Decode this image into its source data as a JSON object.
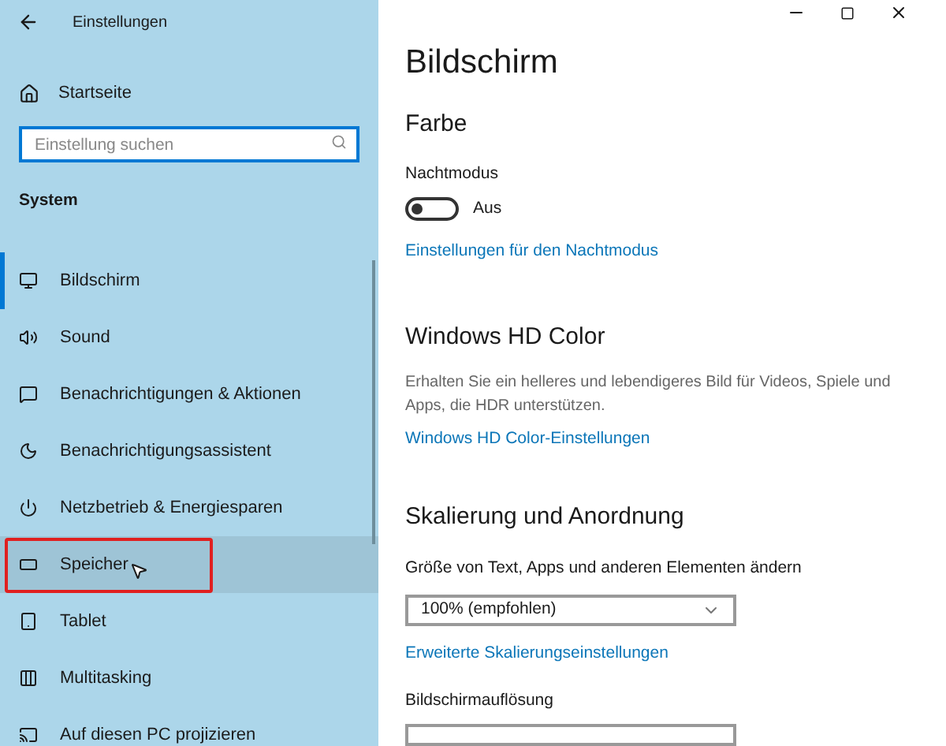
{
  "window": {
    "title": "Einstellungen"
  },
  "sidebar": {
    "home": "Startseite",
    "search": {
      "placeholder": "Einstellung suchen"
    },
    "section": "System",
    "items": [
      {
        "label": "Bildschirm",
        "kind": "monitor",
        "selected": true,
        "hovered": false,
        "annotated": false
      },
      {
        "label": "Sound",
        "kind": "sound",
        "selected": false,
        "hovered": false,
        "annotated": false
      },
      {
        "label": "Benachrichtigungen & Aktionen",
        "kind": "message",
        "selected": false,
        "hovered": false,
        "annotated": false
      },
      {
        "label": "Benachrichtigungsassistent",
        "kind": "moon",
        "selected": false,
        "hovered": false,
        "annotated": false
      },
      {
        "label": "Netzbetrieb & Energiesparen",
        "kind": "power",
        "selected": false,
        "hovered": false,
        "annotated": false
      },
      {
        "label": "Speicher",
        "kind": "storage",
        "selected": false,
        "hovered": true,
        "annotated": true
      },
      {
        "label": "Tablet",
        "kind": "tablet",
        "selected": false,
        "hovered": false,
        "annotated": false
      },
      {
        "label": "Multitasking",
        "kind": "multitask",
        "selected": false,
        "hovered": false,
        "annotated": false
      },
      {
        "label": "Auf diesen PC projizieren",
        "kind": "project",
        "selected": false,
        "hovered": false,
        "annotated": false
      }
    ]
  },
  "page": {
    "title": "Bildschirm",
    "color": {
      "heading": "Farbe",
      "toggle": {
        "label": "Nachtmodus",
        "on": false,
        "state": "Aus"
      },
      "link": "Einstellungen für den Nachtmodus"
    },
    "hd": {
      "heading": "Windows HD Color",
      "description": "Erhalten Sie ein helleres und lebendigeres Bild für Videos, Spiele und Apps, die HDR unterstützen.",
      "link": "Windows HD Color-Einstellungen"
    },
    "scale": {
      "heading": "Skalierung und Anordnung",
      "size_label": "Größe von Text, Apps und anderen Elementen ändern",
      "size_value": "100% (empfohlen)",
      "link": "Erweiterte Skalierungseinstellungen",
      "resolution_label": "Bildschirmauflösung"
    }
  }
}
